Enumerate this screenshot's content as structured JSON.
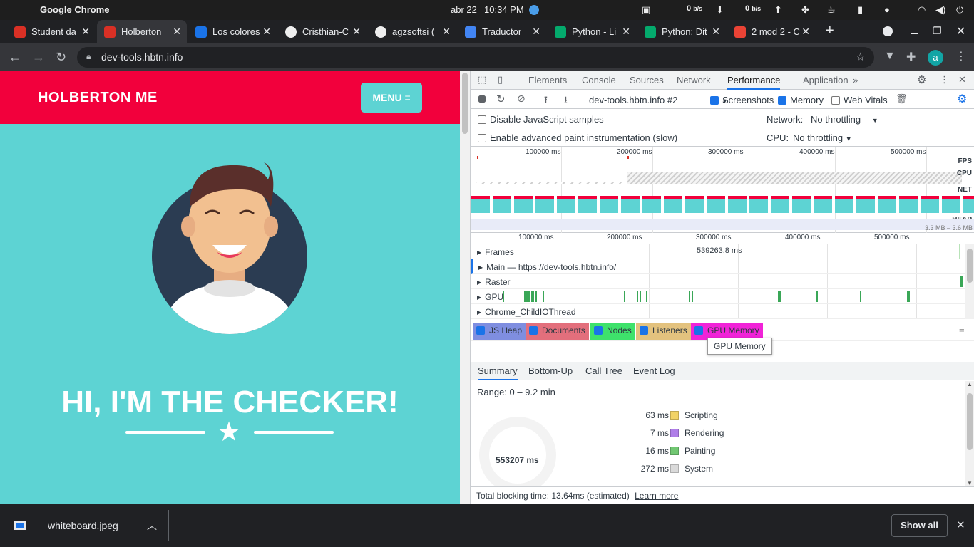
{
  "os": {
    "app": "Google Chrome",
    "date": "abr 22",
    "time": "10:34 PM",
    "net_down": "0",
    "net_down_unit": "b/s",
    "net_up": "0",
    "net_up_unit": "b/s"
  },
  "tabs": [
    {
      "title": "Student da",
      "color": "#d93025"
    },
    {
      "title": "Holberton",
      "color": "#d93025",
      "active": true
    },
    {
      "title": "Los colores",
      "color": "#1a73e8"
    },
    {
      "title": "Cristhian-C",
      "color": "#ffffff"
    },
    {
      "title": "agzsoftsi (",
      "color": "#ffffff"
    },
    {
      "title": "Traductor",
      "color": "#4285f4"
    },
    {
      "title": "Python - Li",
      "color": "#04aa6d"
    },
    {
      "title": "Python: Dit",
      "color": "#04aa6d"
    },
    {
      "title": "2 mod 2 - C",
      "color": "#ea4335"
    }
  ],
  "address": {
    "url": "dev-tools.hbtn.info",
    "avatar": "a"
  },
  "page": {
    "brand": "HOLBERTON ME",
    "menu": "MENU",
    "headline": "HI, I'M THE CHECKER!"
  },
  "devtools": {
    "tabs": [
      "Elements",
      "Console",
      "Sources",
      "Network",
      "Performance",
      "Application"
    ],
    "active_tab": "Performance",
    "toolbar": {
      "profile": "dev-tools.hbtn.info #2",
      "screenshots": "Screenshots",
      "memory": "Memory",
      "web_vitals": "Web Vitals"
    },
    "settings": {
      "disable_js": "Disable JavaScript samples",
      "paint": "Enable advanced paint instrumentation (slow)",
      "network_label": "Network:",
      "network_value": "No throttling",
      "cpu_label": "CPU:",
      "cpu_value": "No throttling"
    },
    "overview": {
      "ticks": [
        "100000 ms",
        "200000 ms",
        "300000 ms",
        "400000 ms",
        "500000 ms"
      ],
      "labels": {
        "fps": "FPS",
        "cpu": "CPU",
        "net": "NET",
        "heap": "HEAP"
      },
      "heap_range": "3.3 MB – 3.6 MB"
    },
    "timeline": {
      "ticks": [
        "100000 ms",
        "200000 ms",
        "300000 ms",
        "400000 ms",
        "500000 ms"
      ],
      "frames_value": "539263.8 ms",
      "tracks": [
        "Frames",
        "Main — https://dev-tools.hbtn.info/",
        "Raster",
        "GPU",
        "Chrome_ChildIOThread"
      ]
    },
    "memory_counters": [
      {
        "label": "JS Heap",
        "color": "#7f8ee0"
      },
      {
        "label": "Documents",
        "color": "#e36f7c"
      },
      {
        "label": "Nodes",
        "color": "#3ee26b"
      },
      {
        "label": "Listeners",
        "color": "#e3c27e"
      },
      {
        "label": "GPU Memory",
        "color": "#f123d8"
      }
    ],
    "tooltip": "GPU Memory",
    "bottom_tabs": [
      "Summary",
      "Bottom-Up",
      "Call Tree",
      "Event Log"
    ],
    "summary": {
      "range": "Range: 0 – 9.2 min",
      "total": "553207 ms",
      "rows": [
        {
          "value": "63 ms",
          "name": "Scripting",
          "color": "#f2d365"
        },
        {
          "value": "7 ms",
          "name": "Rendering",
          "color": "#af7ee8"
        },
        {
          "value": "16 ms",
          "name": "Painting",
          "color": "#71c772"
        },
        {
          "value": "272 ms",
          "name": "System",
          "color": "#dadada"
        }
      ]
    },
    "footer": {
      "text": "Total blocking time: 13.64ms (estimated)",
      "link": "Learn more"
    }
  },
  "download": {
    "file": "whiteboard.jpeg",
    "show_all": "Show all"
  }
}
